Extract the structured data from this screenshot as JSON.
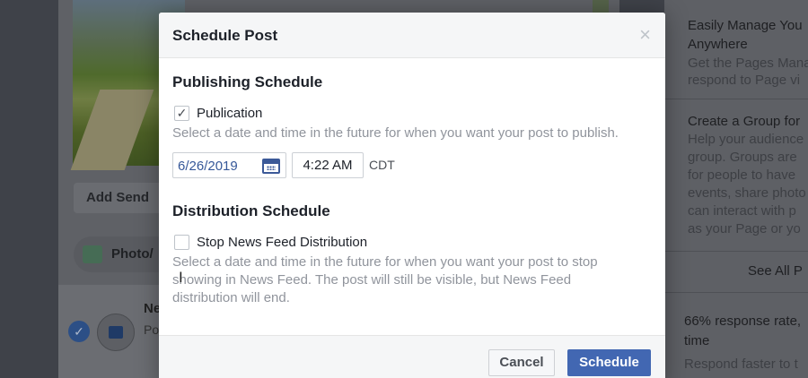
{
  "background": {
    "add_send_label": "Add Send",
    "photo_chip_label": "Photo/",
    "ne_text": "Ne",
    "po_text": "Po",
    "right_column": {
      "item1_title_1": "Easily Manage You",
      "item1_title_2": "Anywhere",
      "item1_desc_1": "Get the Pages Mana",
      "item1_desc_2": "respond to Page vi",
      "item2_title": "Create a Group for",
      "item2_desc": [
        "Help your audience",
        "group. Groups are",
        "for people to have",
        "events, share photo",
        "can interact with p",
        "as your Page or yo"
      ],
      "see_all": "See All P",
      "response_rate_1": "66% response rate,",
      "response_rate_2": "time",
      "respond_faster": "Respond faster to t"
    }
  },
  "modal": {
    "title": "Schedule Post",
    "close_glyph": "×",
    "publishing": {
      "heading": "Publishing Schedule",
      "checkbox_label": "Publication",
      "checked_glyph": "✓",
      "help": "Select a date and time in the future for when you want your post to publish.",
      "date_value": "6/26/2019",
      "time_value": "4:22 AM",
      "timezone": "CDT"
    },
    "distribution": {
      "heading": "Distribution Schedule",
      "checkbox_label": "Stop News Feed Distribution",
      "help_1": "Select a date and time in the future for when you want your post to stop",
      "help_2": "showing in News Feed. The post will still be visible, but News Feed",
      "help_3": "distribution will end."
    },
    "buttons": {
      "cancel": "Cancel",
      "schedule": "Schedule"
    }
  },
  "cursor_glyph": "I",
  "colors": {
    "primary_button": "#4267b2",
    "date_text": "#365899",
    "help_text": "#90949c"
  }
}
